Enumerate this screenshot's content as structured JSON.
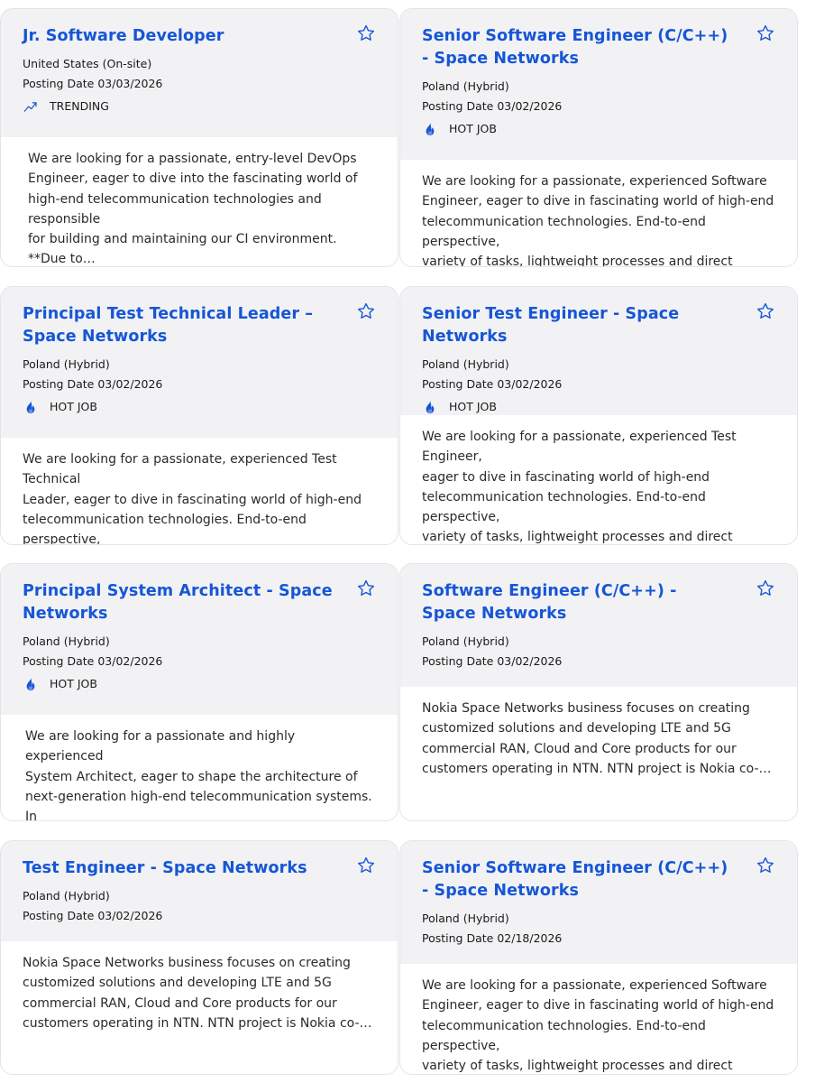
{
  "colors": {
    "title": "#1656d6",
    "accent": "#1656d6",
    "head_bg": "#f2f2f4"
  },
  "posting_label": "Posting Date",
  "jobs": [
    {
      "title": "Jr. Software Developer",
      "location": "United States (On-site)",
      "date": "03/03/2026",
      "badge": "TRENDING",
      "badge_icon": "trending-up-icon",
      "description": "We are looking for a passionate, entry-level DevOps\nEngineer, eager to dive into the fascinating world of\nhigh-end telecommunication technologies and responsible\nfor building and maintaining our CI environment. **Due to…"
    },
    {
      "title": "Senior Software Engineer (C/C++) - Space Networks",
      "location": "Poland (Hybrid)",
      "date": "03/02/2026",
      "badge": "HOT JOB",
      "badge_icon": "flame-icon",
      "description": "We are looking for a passionate, experienced Software\nEngineer, eager to dive in fascinating world of high-end\ntelecommunication technologies. End-to-end perspective,\nvariety of tasks, lightweight processes and direct contact…"
    },
    {
      "title": "Principal Test Technical Leader – Space Networks",
      "location": "Poland (Hybrid)",
      "date": "03/02/2026",
      "badge": "HOT JOB",
      "badge_icon": "flame-icon",
      "description": "We are looking for a passionate, experienced Test Technical\nLeader, eager to dive in fascinating world of high-end\ntelecommunication technologies. End-to-end perspective,\nvariety of tasks, lightweight processes and direct contact…"
    },
    {
      "title": "Senior Test Engineer - Space Networks",
      "location": "Poland (Hybrid)",
      "date": "03/02/2026",
      "badge": "HOT JOB",
      "badge_icon": "flame-icon",
      "description": "We are looking for a passionate, experienced Test Engineer,\neager to dive in fascinating world of high-end\ntelecommunication technologies. End-to-end perspective,\nvariety of tasks, lightweight processes and direct contact…"
    },
    {
      "title": "Principal System Architect - Space Networks",
      "location": "Poland (Hybrid)",
      "date": "03/02/2026",
      "badge": "HOT JOB",
      "badge_icon": "flame-icon",
      "description": "We are looking for a passionate and highly experienced\nSystem Architect, eager to shape the architecture of\nnext-generation high-end telecommunication systems. In\nthis role, you will drive end-to-end solutions, influence ke…"
    },
    {
      "title": "Software Engineer (C/C++) - Space Networks",
      "location": "Poland (Hybrid)",
      "date": "03/02/2026",
      "badge": "",
      "badge_icon": "",
      "description": "Nokia Space Networks business focuses on creating\ncustomized solutions and developing LTE and 5G\ncommercial RAN, Cloud and Core products for our\ncustomers operating in NTN. NTN project is Nokia co-…"
    },
    {
      "title": "Test Engineer - Space Networks",
      "location": "Poland (Hybrid)",
      "date": "03/02/2026",
      "badge": "",
      "badge_icon": "",
      "description": "Nokia Space Networks business focuses on creating\ncustomized solutions and developing LTE and 5G\ncommercial RAN, Cloud and Core products for our\ncustomers operating in NTN. NTN project is Nokia co-…"
    },
    {
      "title": "Senior Software Engineer (C/C++) - Space Networks",
      "location": "Poland (Hybrid)",
      "date": "02/18/2026",
      "badge": "",
      "badge_icon": "",
      "description": "We are looking for a passionate, experienced Software\nEngineer, eager to dive in fascinating world of high-end\ntelecommunication technologies. End-to-end perspective,\nvariety of tasks, lightweight processes and direct contact…"
    }
  ]
}
